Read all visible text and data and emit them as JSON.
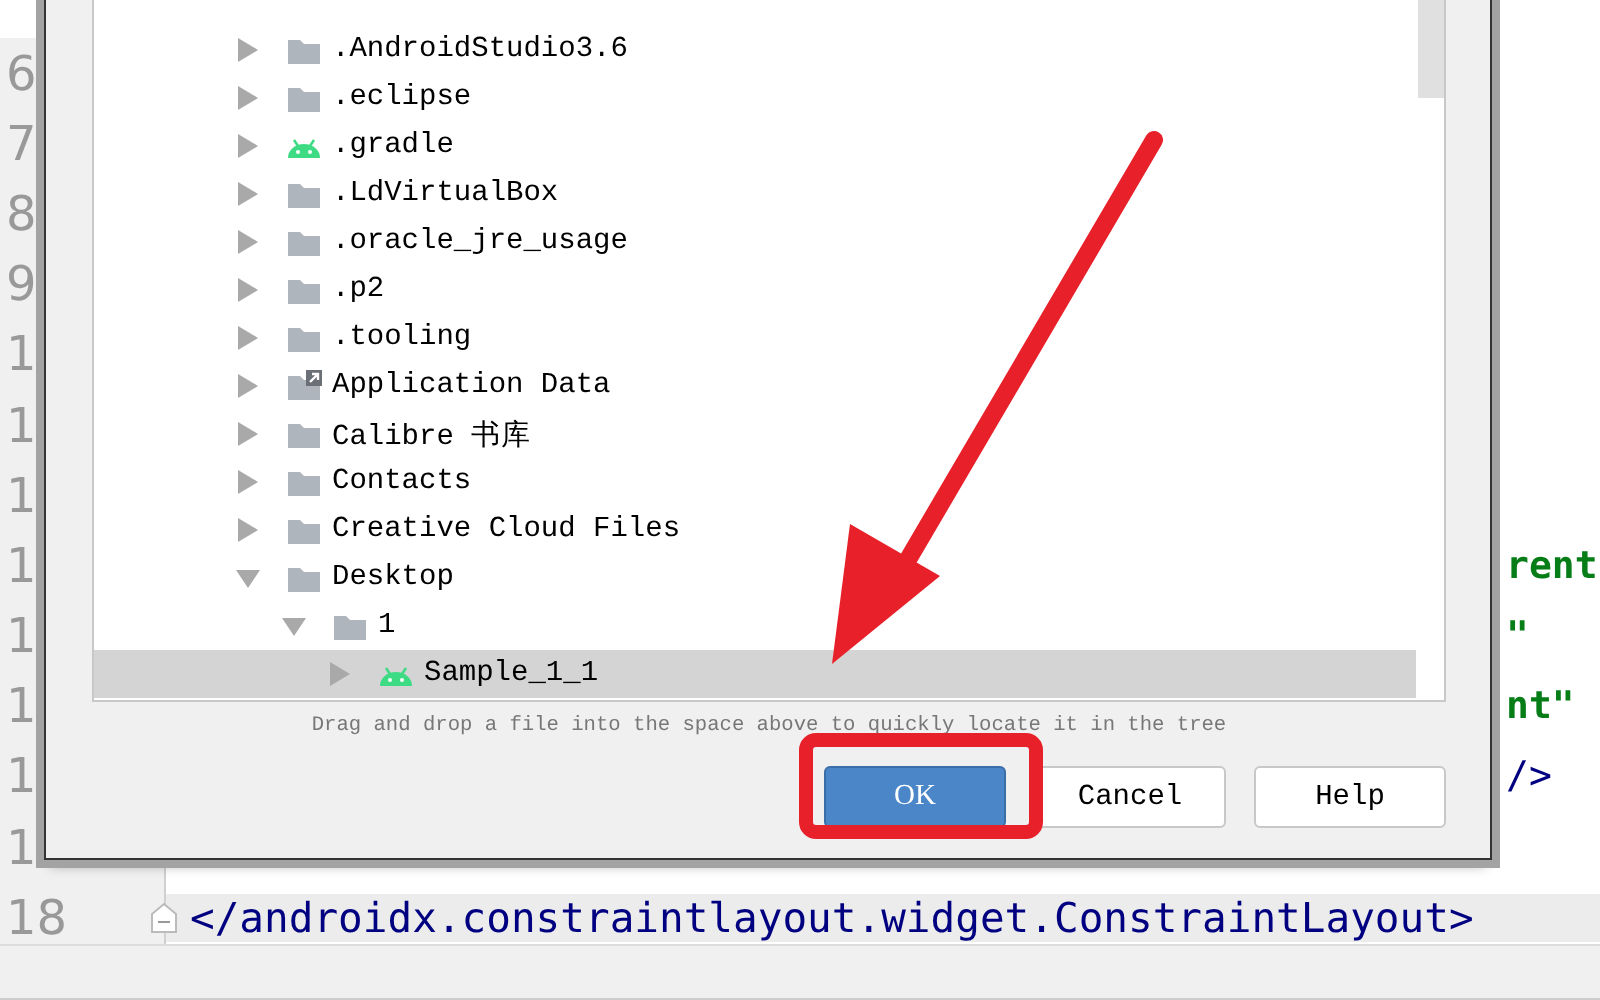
{
  "editor": {
    "lines": [
      {
        "number": "6",
        "current": false
      },
      {
        "number": "7",
        "current": false
      },
      {
        "number": "8",
        "current": false
      },
      {
        "number": "9",
        "current": false
      },
      {
        "number": "1",
        "current": false
      },
      {
        "number": "1",
        "current": false
      },
      {
        "number": "1",
        "current": false
      },
      {
        "number": "1",
        "code": "rent",
        "kind": "string",
        "current": false
      },
      {
        "number": "1",
        "code": "\"",
        "kind": "string",
        "current": false
      },
      {
        "number": "1",
        "code": "nt\"",
        "kind": "string",
        "current": false
      },
      {
        "number": "1",
        "code": "/>",
        "kind": "tag",
        "current": false
      },
      {
        "number": "1",
        "current": false
      },
      {
        "number": "18",
        "code": "</androidx.constraintlayout.widget.ConstraintLayout>",
        "kind": "tag",
        "current": true
      }
    ]
  },
  "dialog": {
    "tree": {
      "items": [
        {
          "label": ".AndroidStudio3.6",
          "kind": "folder",
          "expanded": false,
          "selected": false
        },
        {
          "label": ".eclipse",
          "kind": "folder",
          "expanded": false,
          "selected": false
        },
        {
          "label": ".gradle",
          "kind": "android",
          "expanded": false,
          "selected": false
        },
        {
          "label": ".LdVirtualBox",
          "kind": "folder",
          "expanded": false,
          "selected": false
        },
        {
          "label": ".oracle_jre_usage",
          "kind": "folder",
          "expanded": false,
          "selected": false
        },
        {
          "label": ".p2",
          "kind": "folder",
          "expanded": false,
          "selected": false
        },
        {
          "label": ".tooling",
          "kind": "folder",
          "expanded": false,
          "selected": false
        },
        {
          "label": "Application Data",
          "kind": "link-folder",
          "expanded": false,
          "selected": false
        },
        {
          "label": "Calibre 书库",
          "kind": "folder",
          "expanded": false,
          "selected": false
        },
        {
          "label": "Contacts",
          "kind": "folder",
          "expanded": false,
          "selected": false
        },
        {
          "label": "Creative Cloud Files",
          "kind": "folder",
          "expanded": false,
          "selected": false
        },
        {
          "label": "Desktop",
          "kind": "folder",
          "expanded": true,
          "selected": false,
          "children": [
            {
              "label": "1",
              "kind": "folder",
              "expanded": true,
              "selected": false,
              "children": [
                {
                  "label": "Sample_1_1",
                  "kind": "android",
                  "expanded": false,
                  "selected": true
                }
              ]
            }
          ]
        }
      ]
    },
    "hint": "Drag and drop a file into the space above to quickly locate it in the tree",
    "buttons": [
      {
        "label": "OK",
        "default": true
      },
      {
        "label": "Cancel",
        "default": false
      },
      {
        "label": "Help",
        "default": false
      }
    ]
  }
}
